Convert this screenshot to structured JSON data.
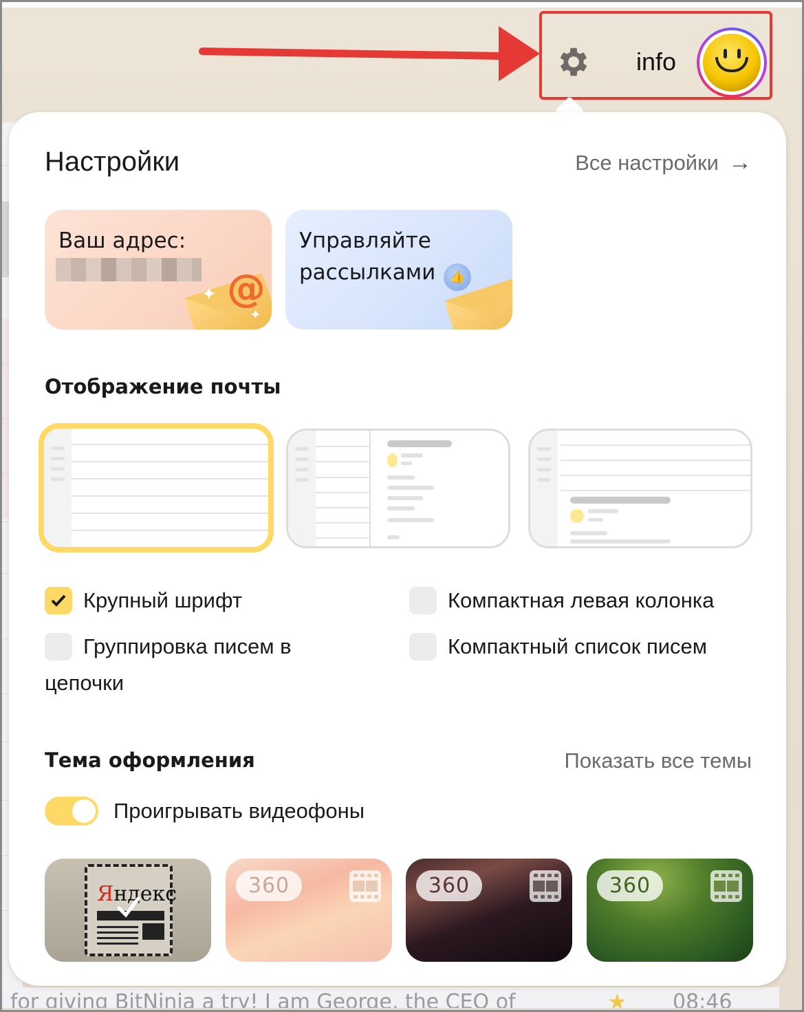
{
  "header": {
    "user_name": "info",
    "icons": {
      "settings": "gear-icon",
      "avatar": "smiley-avatar"
    },
    "annotation_color": "#e53935"
  },
  "settings_panel": {
    "title": "Настройки",
    "all_settings_link": "Все настройки",
    "all_settings_arrow": "→",
    "promos": [
      {
        "title": "Ваш адрес:",
        "value_hidden": true
      },
      {
        "line1": "Управляйте",
        "line2": "рассылками"
      }
    ],
    "display_section": {
      "title": "Отображение почты",
      "layouts": [
        {
          "name": "list",
          "selected": true
        },
        {
          "name": "two-pane-vertical",
          "selected": false
        },
        {
          "name": "two-pane-horizontal",
          "selected": false
        }
      ],
      "options": [
        {
          "label": "Крупный шрифт",
          "checked": true
        },
        {
          "label": "Компактная левая колонка",
          "checked": false
        },
        {
          "label": "Группировка писем в",
          "label_cont": "цепочки",
          "checked": false
        },
        {
          "label": "Компактный список писем",
          "checked": false
        }
      ]
    },
    "theme_section": {
      "title": "Тема оформления",
      "show_all_link": "Показать все темы",
      "video_toggle": {
        "label": "Проигрывать видеофоны",
        "on": true
      },
      "themes": [
        {
          "name": "yandex-mail-classic",
          "logo_first": "Я",
          "logo_rest": "ндекс",
          "selected": true
        },
        {
          "name": "360-peach",
          "badge": "360",
          "video": true,
          "selected": false
        },
        {
          "name": "360-dark",
          "badge": "360",
          "video": true,
          "selected": false
        },
        {
          "name": "360-grass",
          "badge": "360",
          "video": true,
          "selected": false
        }
      ]
    },
    "accent_color": "#ffd966"
  },
  "background_mail": {
    "snippet": "for giving BitNinja a try! I am George, the CEO of",
    "time": "08:46",
    "starred": true
  }
}
